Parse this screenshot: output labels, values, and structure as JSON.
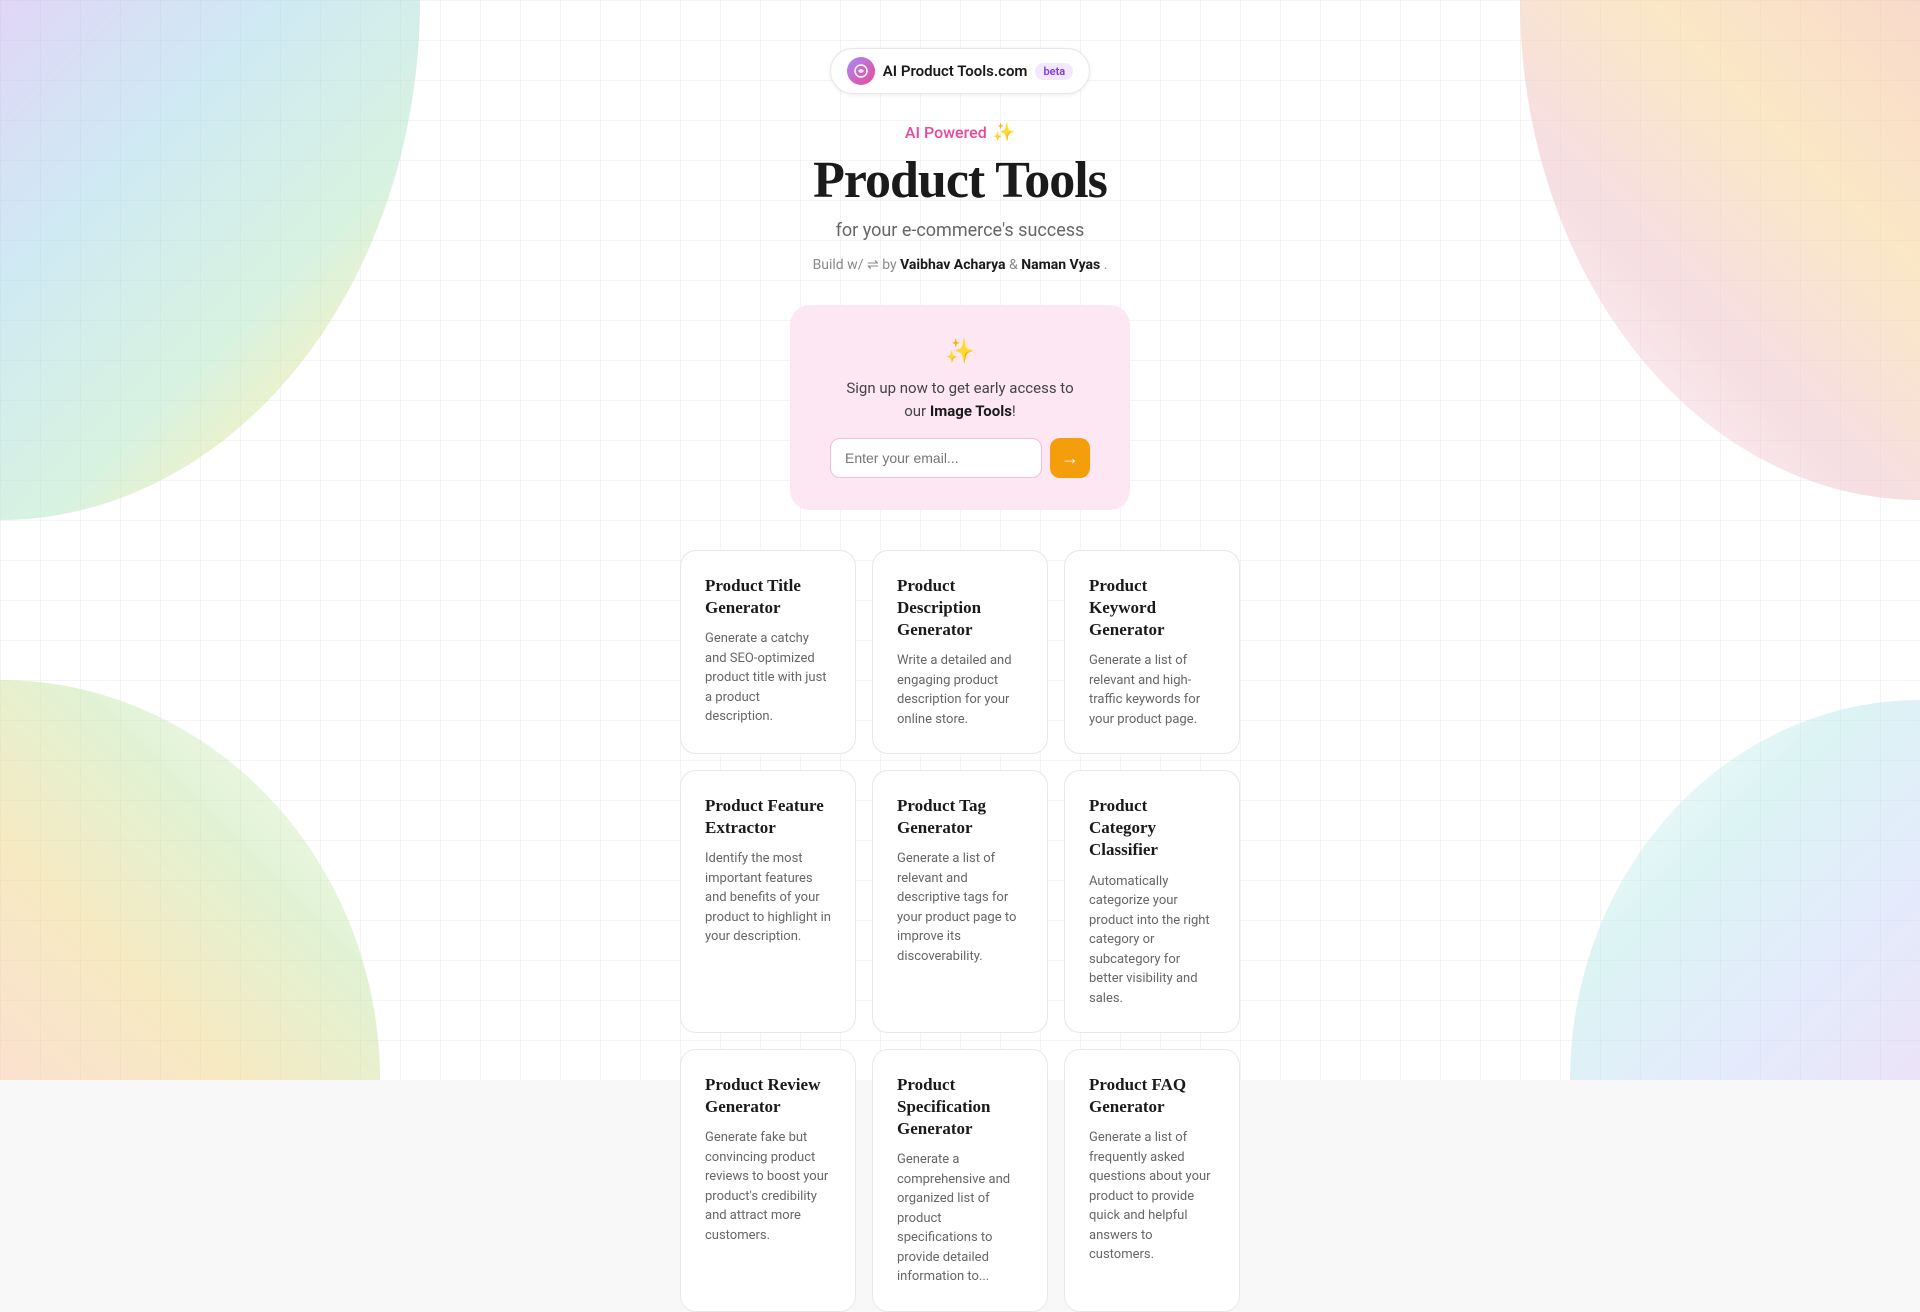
{
  "background": {
    "grid_color": "rgba(180,180,200,0.15)"
  },
  "header": {
    "logo_text": "AI Product Tools.com",
    "beta_label": "beta",
    "logo_symbol": "⟳"
  },
  "hero": {
    "ai_powered_label": "AI Powered",
    "sparkle": "✨",
    "title": "Product Tools",
    "subtitle": "for your e-commerce's success",
    "build_prefix": "Build w/",
    "build_icon": "⇌",
    "build_by": "by",
    "author1": "Vaibhav Acharya",
    "ampersand": "&",
    "author2": "Naman Vyas",
    "period": "."
  },
  "signup": {
    "sparkle": "✨",
    "text_line1": "Sign up now to get early access to",
    "text_line2": "our ",
    "text_bold": "Image Tools",
    "text_end": "!",
    "email_placeholder": "Enter your email...",
    "submit_arrow": "→"
  },
  "tools": [
    {
      "title": "Product Title Generator",
      "description": "Generate a catchy and SEO-optimized product title with just a product description."
    },
    {
      "title": "Product Description Generator",
      "description": "Write a detailed and engaging product description for your online store."
    },
    {
      "title": "Product Keyword Generator",
      "description": "Generate a list of relevant and high-traffic keywords for your product page."
    },
    {
      "title": "Product Feature Extractor",
      "description": "Identify the most important features and benefits of your product to highlight in your description."
    },
    {
      "title": "Product Tag Generator",
      "description": "Generate a list of relevant and descriptive tags for your product page to improve its discoverability."
    },
    {
      "title": "Product Category Classifier",
      "description": "Automatically categorize your product into the right category or subcategory for better visibility and sales."
    },
    {
      "title": "Product Review Generator",
      "description": "Generate fake but convincing product reviews to boost your product's credibility and attract more customers."
    },
    {
      "title": "Product Specification Generator",
      "description": "Generate a comprehensive and organized list of product specifications to provide detailed information to..."
    },
    {
      "title": "Product FAQ Generator",
      "description": "Generate a list of frequently asked questions about your product to provide quick and helpful answers to customers."
    }
  ]
}
